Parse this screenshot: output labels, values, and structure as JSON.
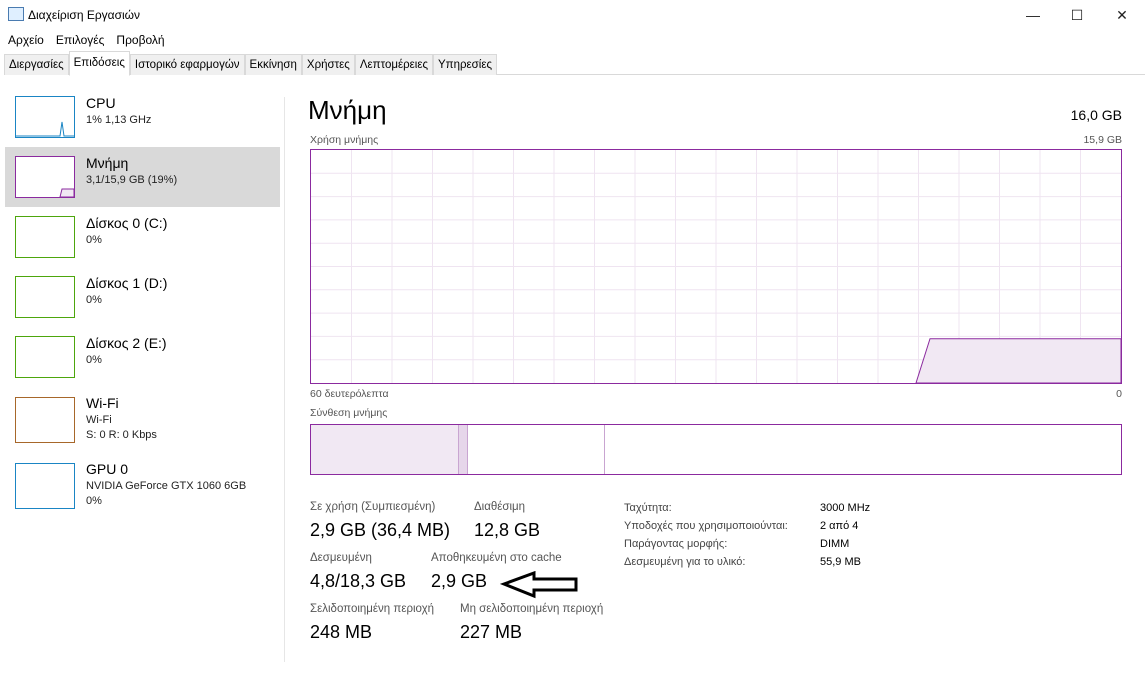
{
  "window": {
    "title": "Διαχείριση Εργασιών",
    "minimize": "—",
    "maximize": "☐",
    "close": "✕"
  },
  "menu": [
    "Αρχείο",
    "Επιλογές",
    "Προβολή"
  ],
  "tabs": [
    "Διεργασίες",
    "Επιδόσεις",
    "Ιστορικό εφαρμογών",
    "Εκκίνηση",
    "Χρήστες",
    "Λεπτομέρειες",
    "Υπηρεσίες"
  ],
  "active_tab": "Επιδόσεις",
  "sidebar": [
    {
      "name": "CPU",
      "sub": "1% 1,13 GHz",
      "color": "#1a85c4"
    },
    {
      "name": "Μνήμη",
      "sub": "3,1/15,9 GB (19%)",
      "color": "#8b2a9f",
      "selected": true
    },
    {
      "name": "Δίσκος 0 (C:)",
      "sub": "0%",
      "color": "#4da60c"
    },
    {
      "name": "Δίσκος 1 (D:)",
      "sub": "0%",
      "color": "#4da60c"
    },
    {
      "name": "Δίσκος 2 (E:)",
      "sub": "0%",
      "color": "#4da60c"
    },
    {
      "name": "Wi-Fi",
      "sub": "Wi-Fi",
      "sub2": "S: 0 R: 0 Kbps",
      "color": "#a7672a"
    },
    {
      "name": "GPU 0",
      "sub": "NVIDIA GeForce GTX 1060 6GB",
      "sub2": "0%",
      "color": "#1a85c4"
    }
  ],
  "main": {
    "title": "Μνήμη",
    "total": "16,0 GB",
    "usage_label": "Χρήση μνήμης",
    "usage_max": "15,9 GB",
    "time_left": "60 δευτερόλεπτα",
    "time_right": "0",
    "composition_label": "Σύνθεση μνήμης",
    "accent": "#8b2a9f",
    "usage_percent_history_end": 19,
    "stats": {
      "in_use_label": "Σε χρήση (Συμπιεσμένη)",
      "in_use": "2,9 GB (36,4 MB)",
      "available_label": "Διαθέσιμη",
      "available": "12,8 GB",
      "committed_label": "Δεσμευμένη",
      "committed": "4,8/18,3 GB",
      "cached_label": "Αποθηκευμένη στο cache",
      "cached": "2,9 GB",
      "paged_label": "Σελιδοποιημένη περιοχή",
      "paged": "248 MB",
      "nonpaged_label": "Μη σελιδοποιημένη περιοχή",
      "nonpaged": "227 MB"
    },
    "details": [
      {
        "label": "Ταχύτητα:",
        "value": "3000 MHz"
      },
      {
        "label": "Υποδοχές που χρησιμοποιούνται:",
        "value": "2 από 4"
      },
      {
        "label": "Παράγοντας μορφής:",
        "value": "DIMM"
      },
      {
        "label": "Δεσμευμένη για το υλικό:",
        "value": "55,9 MB"
      }
    ]
  }
}
